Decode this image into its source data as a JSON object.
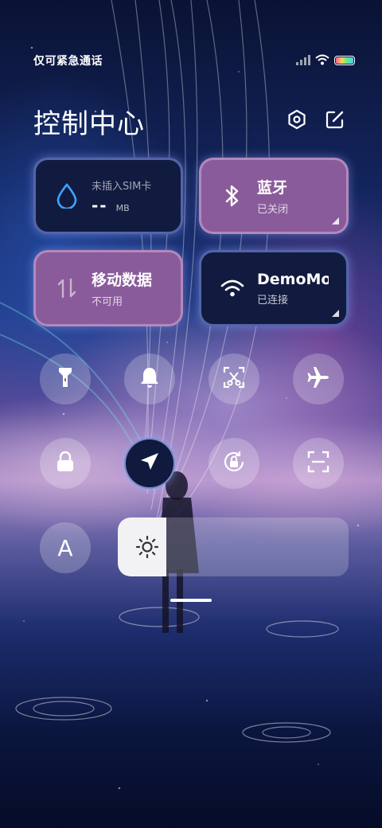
{
  "status_bar": {
    "carrier_text": "仅可紧急通话",
    "icons": [
      "signal-icon",
      "wifi-icon",
      "battery-icon"
    ]
  },
  "header": {
    "title": "控制中心",
    "actions": [
      "settings-icon",
      "edit-icon"
    ]
  },
  "tiles": {
    "data": {
      "line1": "未插入SIM卡",
      "value": "--",
      "unit": "MB"
    },
    "bluetooth": {
      "title": "蓝牙",
      "status": "已关闭"
    },
    "mobile_data": {
      "title": "移动数据",
      "status": "不可用"
    },
    "wifi": {
      "title": "DemoMod",
      "status": "已连接"
    }
  },
  "toggles": [
    {
      "icon": "flashlight-icon",
      "active": false
    },
    {
      "icon": "bell-icon",
      "active": false
    },
    {
      "icon": "screenshot-icon",
      "active": false
    },
    {
      "icon": "airplane-icon",
      "active": false
    },
    {
      "icon": "lock-icon",
      "active": false
    },
    {
      "icon": "location-icon",
      "active": true
    },
    {
      "icon": "rotation-lock-icon",
      "active": false
    },
    {
      "icon": "scan-icon",
      "active": false
    },
    {
      "icon": "font-size-icon",
      "active": false
    }
  ],
  "font_toggle_label": "A",
  "brightness": {
    "level": 0.21,
    "icon": "sun-icon"
  },
  "colors": {
    "tile_dark": "#111b3f",
    "tile_purple": "#8a5b9a",
    "wifi_icon_accent": "#3fa2ff"
  }
}
